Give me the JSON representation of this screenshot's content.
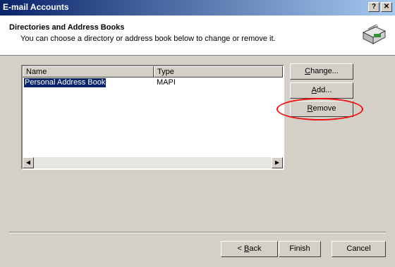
{
  "window": {
    "title": "E-mail Accounts",
    "help_label": "?",
    "close_label": "✕"
  },
  "header": {
    "title": "Directories and Address Books",
    "subtitle": "You can choose a directory or address book below to change or remove it."
  },
  "list": {
    "columns": [
      "Name",
      "Type"
    ],
    "rows": [
      {
        "name": "Personal Address Book",
        "type": "MAPI",
        "selected": true
      }
    ]
  },
  "buttons": {
    "change": {
      "pre": "",
      "mnemonic": "C",
      "post": "hange..."
    },
    "add": {
      "pre": "",
      "mnemonic": "A",
      "post": "dd..."
    },
    "remove": {
      "pre": "",
      "mnemonic": "R",
      "post": "emove"
    },
    "back": {
      "pre": "< ",
      "mnemonic": "B",
      "post": "ack"
    },
    "finish_label": "Finish",
    "cancel_label": "Cancel"
  },
  "colors": {
    "titlebar": "#0a246a",
    "annotation_ring": "#e11111"
  },
  "icons": [
    "help-icon",
    "close-icon",
    "address-book-icon",
    "scroll-left-icon",
    "scroll-right-icon"
  ]
}
